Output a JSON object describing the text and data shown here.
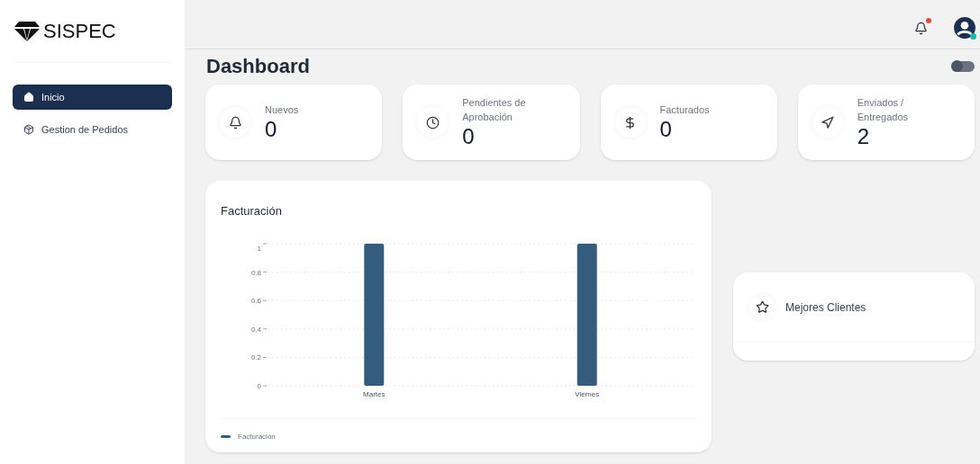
{
  "sidebar": {
    "logo": "SISPEC",
    "items": [
      {
        "label": "Inicio",
        "kind": "home",
        "selected": true
      },
      {
        "label": "Gestion de Pedidos",
        "kind": "box",
        "selected": false
      }
    ]
  },
  "header": {
    "notification_unread": true,
    "user_online": true
  },
  "page_title": "Dashboard",
  "theme_toggle": {
    "on": false
  },
  "stats": [
    {
      "label": "Nuevos",
      "value": "0",
      "kind": "bell"
    },
    {
      "label": "Pendientes de Aprobación",
      "value": "0",
      "kind": "clock"
    },
    {
      "label": "Facturados",
      "value": "0",
      "kind": "dollar"
    },
    {
      "label": "Enviados / Entregados",
      "value": "2",
      "kind": "send"
    }
  ],
  "billing": {
    "title": "Facturación",
    "chart_data": {
      "type": "bar",
      "categories": [
        "Martes",
        "Viernes"
      ],
      "series": [
        {
          "name": "Facturación",
          "color": "#355c7d",
          "values": [
            1,
            1
          ]
        }
      ],
      "ylim": [
        0,
        1
      ],
      "yticks": [
        0,
        0.2,
        0.4,
        0.6,
        0.8,
        1
      ],
      "grid": true
    }
  },
  "best_clients": {
    "title": "Mejores Clientes"
  }
}
